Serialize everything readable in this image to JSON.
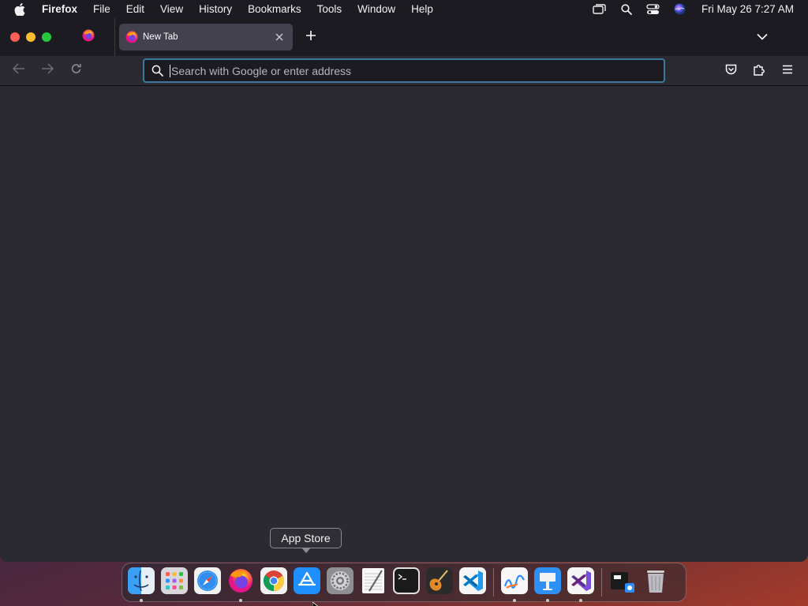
{
  "menubar": {
    "app_name": "Firefox",
    "items": [
      "File",
      "Edit",
      "View",
      "History",
      "Bookmarks",
      "Tools",
      "Window",
      "Help"
    ],
    "clock": "Fri May 26  7:27 AM",
    "status_icons": [
      "screen-mirroring-icon",
      "spotlight-search-icon",
      "control-center-icon",
      "siri-icon"
    ]
  },
  "tabbar": {
    "pinned_tab_icon": "firefox-icon",
    "active_tab": {
      "title": "New Tab",
      "icon": "firefox-icon"
    }
  },
  "navbar": {
    "url_placeholder": "Search with Google or enter address",
    "url_value": ""
  },
  "tooltip": {
    "text": "App Store"
  },
  "dock": {
    "apps": [
      {
        "name": "Finder",
        "icon": "finder-icon",
        "running": true
      },
      {
        "name": "Launchpad",
        "icon": "launchpad-icon",
        "running": false
      },
      {
        "name": "Safari",
        "icon": "safari-icon",
        "running": false
      },
      {
        "name": "Firefox",
        "icon": "firefox-icon",
        "running": true
      },
      {
        "name": "Chrome",
        "icon": "chrome-icon",
        "running": false
      },
      {
        "name": "App Store",
        "icon": "app-store-icon",
        "running": false
      },
      {
        "name": "System Preferences",
        "icon": "system-preferences-icon",
        "running": false
      },
      {
        "name": "TextEdit",
        "icon": "textedit-icon",
        "running": false
      },
      {
        "name": "Terminal",
        "icon": "terminal-icon",
        "running": false
      },
      {
        "name": "GarageBand",
        "icon": "garageband-icon",
        "running": false
      },
      {
        "name": "Visual Studio Code",
        "icon": "vscode-icon",
        "running": false
      },
      {
        "name": "Freeform",
        "icon": "freeform-icon",
        "running": true
      },
      {
        "name": "Keynote",
        "icon": "keynote-icon",
        "running": true
      },
      {
        "name": "Visual Studio",
        "icon": "visual-studio-icon",
        "running": true
      },
      {
        "name": "Downloads",
        "icon": "downloads-stack-icon",
        "running": false
      },
      {
        "name": "Trash",
        "icon": "trash-icon",
        "running": false
      }
    ]
  },
  "colors": {
    "menubar_bg": "#1c1b22",
    "toolbar_bg": "#2b2a33",
    "urlbar_focus": "#3a7a9c",
    "tab_active_bg": "#42414d"
  }
}
